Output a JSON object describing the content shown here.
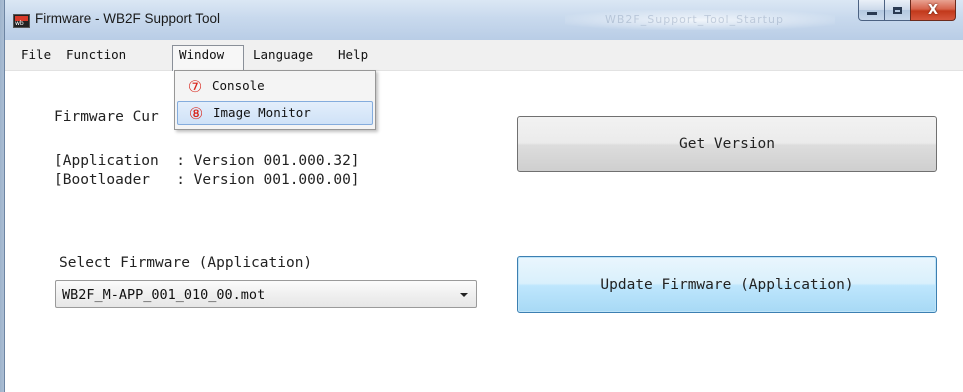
{
  "window": {
    "title": "Firmware - WB2F Support Tool",
    "background_title": "WB2F_Support_Tool_Startup"
  },
  "caption_buttons": {
    "close_glyph": "X"
  },
  "menu": {
    "items": [
      {
        "label": "File"
      },
      {
        "label": "Function"
      },
      {
        "label": "Window"
      },
      {
        "label": "Language"
      },
      {
        "label": "Help"
      }
    ],
    "active": "Window"
  },
  "dropdown": {
    "items": [
      {
        "number": "⑦",
        "label": "Console"
      },
      {
        "number": "⑧",
        "label": "Image Monitor"
      }
    ],
    "highlighted": "Image Monitor"
  },
  "main": {
    "firmware_current_label": "Firmware Cur",
    "application_version": "[Application  : Version 001.000.32]",
    "bootloader_version": "[Bootloader   : Version 001.000.00]",
    "select_label": "Select Firmware (Application)",
    "select_value": "WB2F_M-APP_001_010_00.mot",
    "get_version_button": "Get Version",
    "update_button": "Update Firmware (Application)"
  },
  "colors": {
    "accent_number": "#d9261c",
    "focus_border": "#3c7fb1",
    "menu_highlight": "#84acdd"
  }
}
